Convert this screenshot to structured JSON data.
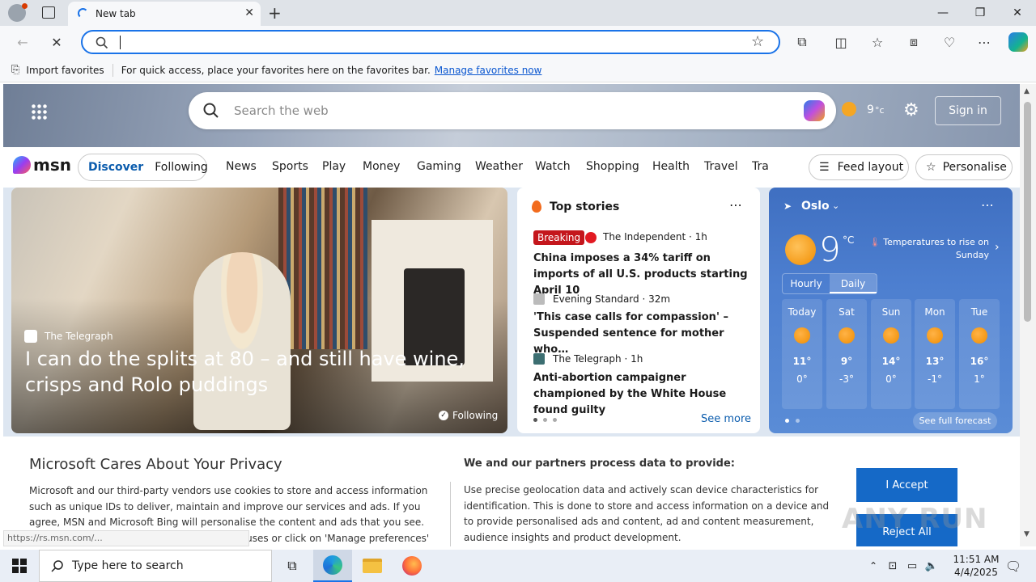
{
  "browser": {
    "tab_title": "New tab",
    "address_value": "",
    "favorites_bar": {
      "import_label": "Import favorites",
      "hint": "For quick access, place your favorites here on the favorites bar.",
      "manage_link": "Manage favorites now"
    },
    "status_url": "https://rs.msn.com/..."
  },
  "msn": {
    "search_placeholder": "Search the web",
    "weather_temp_header": "9",
    "weather_unit_header": "°c",
    "sign_in": "Sign in",
    "logo_text": "msn",
    "tabs": [
      "Discover",
      "Following"
    ],
    "nav": [
      "News",
      "Sports",
      "Play",
      "Money",
      "Gaming",
      "Weather",
      "Watch",
      "Shopping",
      "Health",
      "Travel",
      "Tra"
    ],
    "feed_layout": "Feed layout",
    "personalise": "Personalise"
  },
  "main_story": {
    "source": "The Telegraph",
    "headline": "I can do the splits at 80 – and still have wine, crisps and Rolo puddings",
    "following": "Following"
  },
  "top_stories": {
    "title": "Top stories",
    "items": [
      {
        "badge": "Breaking",
        "source": "The Independent · 1h",
        "headline": "China imposes a 34% tariff on imports of all U.S. products starting April 10"
      },
      {
        "badge": "",
        "source": "Evening Standard · 32m",
        "headline": "'This case calls for compassion' – Suspended sentence for mother who…"
      },
      {
        "badge": "",
        "source": "The Telegraph · 1h",
        "headline": "Anti-abortion campaigner championed by the White House found guilty"
      }
    ],
    "see_more": "See more"
  },
  "weather": {
    "city": "Oslo",
    "temp": "9",
    "unit": "°C",
    "note": "Temperatures to rise on Sunday",
    "modes": [
      "Hourly",
      "Daily"
    ],
    "days": [
      {
        "name": "Today",
        "hi": "11°",
        "lo": "0°"
      },
      {
        "name": "Sat",
        "hi": "9°",
        "lo": "-3°"
      },
      {
        "name": "Sun",
        "hi": "14°",
        "lo": "0°"
      },
      {
        "name": "Mon",
        "hi": "13°",
        "lo": "-1°"
      },
      {
        "name": "Tue",
        "hi": "16°",
        "lo": "1°"
      }
    ],
    "see_full": "See full forecast"
  },
  "privacy": {
    "title": "Microsoft Cares About Your Privacy",
    "body": "Microsoft and our third-party vendors use cookies to store and access information such as unique IDs to deliver, maintain and improve our services and ads. If you agree, MSN and Microsoft Bing will personalise the content and ads that you see. You can select 'I Accept' to consent to these uses or click on 'Manage preferences' to",
    "right_title": "We and our partners process data to provide:",
    "right_body": "Use precise geolocation data and actively scan device characteristics for identification. This is done to store and access information on a device and to provide personalised ads and content, ad and content measurement, audience insights and product development.",
    "accept": "I Accept",
    "reject": "Reject All"
  },
  "taskbar": {
    "search_placeholder": "Type here to search",
    "time": "11:51 AM",
    "date": "4/4/2025"
  },
  "watermark": "ANY RUN"
}
